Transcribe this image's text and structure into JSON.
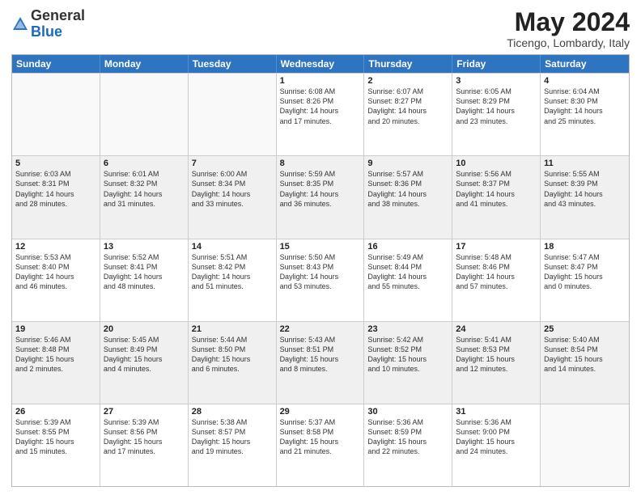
{
  "header": {
    "logo_general": "General",
    "logo_blue": "Blue",
    "month_title": "May 2024",
    "location": "Ticengo, Lombardy, Italy"
  },
  "calendar": {
    "days": [
      "Sunday",
      "Monday",
      "Tuesday",
      "Wednesday",
      "Thursday",
      "Friday",
      "Saturday"
    ],
    "rows": [
      [
        {
          "num": "",
          "info": "",
          "empty": true
        },
        {
          "num": "",
          "info": "",
          "empty": true
        },
        {
          "num": "",
          "info": "",
          "empty": true
        },
        {
          "num": "1",
          "info": "Sunrise: 6:08 AM\nSunset: 8:26 PM\nDaylight: 14 hours\nand 17 minutes.",
          "empty": false
        },
        {
          "num": "2",
          "info": "Sunrise: 6:07 AM\nSunset: 8:27 PM\nDaylight: 14 hours\nand 20 minutes.",
          "empty": false
        },
        {
          "num": "3",
          "info": "Sunrise: 6:05 AM\nSunset: 8:29 PM\nDaylight: 14 hours\nand 23 minutes.",
          "empty": false
        },
        {
          "num": "4",
          "info": "Sunrise: 6:04 AM\nSunset: 8:30 PM\nDaylight: 14 hours\nand 25 minutes.",
          "empty": false
        }
      ],
      [
        {
          "num": "5",
          "info": "Sunrise: 6:03 AM\nSunset: 8:31 PM\nDaylight: 14 hours\nand 28 minutes.",
          "empty": false
        },
        {
          "num": "6",
          "info": "Sunrise: 6:01 AM\nSunset: 8:32 PM\nDaylight: 14 hours\nand 31 minutes.",
          "empty": false
        },
        {
          "num": "7",
          "info": "Sunrise: 6:00 AM\nSunset: 8:34 PM\nDaylight: 14 hours\nand 33 minutes.",
          "empty": false
        },
        {
          "num": "8",
          "info": "Sunrise: 5:59 AM\nSunset: 8:35 PM\nDaylight: 14 hours\nand 36 minutes.",
          "empty": false
        },
        {
          "num": "9",
          "info": "Sunrise: 5:57 AM\nSunset: 8:36 PM\nDaylight: 14 hours\nand 38 minutes.",
          "empty": false
        },
        {
          "num": "10",
          "info": "Sunrise: 5:56 AM\nSunset: 8:37 PM\nDaylight: 14 hours\nand 41 minutes.",
          "empty": false
        },
        {
          "num": "11",
          "info": "Sunrise: 5:55 AM\nSunset: 8:39 PM\nDaylight: 14 hours\nand 43 minutes.",
          "empty": false
        }
      ],
      [
        {
          "num": "12",
          "info": "Sunrise: 5:53 AM\nSunset: 8:40 PM\nDaylight: 14 hours\nand 46 minutes.",
          "empty": false
        },
        {
          "num": "13",
          "info": "Sunrise: 5:52 AM\nSunset: 8:41 PM\nDaylight: 14 hours\nand 48 minutes.",
          "empty": false
        },
        {
          "num": "14",
          "info": "Sunrise: 5:51 AM\nSunset: 8:42 PM\nDaylight: 14 hours\nand 51 minutes.",
          "empty": false
        },
        {
          "num": "15",
          "info": "Sunrise: 5:50 AM\nSunset: 8:43 PM\nDaylight: 14 hours\nand 53 minutes.",
          "empty": false
        },
        {
          "num": "16",
          "info": "Sunrise: 5:49 AM\nSunset: 8:44 PM\nDaylight: 14 hours\nand 55 minutes.",
          "empty": false
        },
        {
          "num": "17",
          "info": "Sunrise: 5:48 AM\nSunset: 8:46 PM\nDaylight: 14 hours\nand 57 minutes.",
          "empty": false
        },
        {
          "num": "18",
          "info": "Sunrise: 5:47 AM\nSunset: 8:47 PM\nDaylight: 15 hours\nand 0 minutes.",
          "empty": false
        }
      ],
      [
        {
          "num": "19",
          "info": "Sunrise: 5:46 AM\nSunset: 8:48 PM\nDaylight: 15 hours\nand 2 minutes.",
          "empty": false
        },
        {
          "num": "20",
          "info": "Sunrise: 5:45 AM\nSunset: 8:49 PM\nDaylight: 15 hours\nand 4 minutes.",
          "empty": false
        },
        {
          "num": "21",
          "info": "Sunrise: 5:44 AM\nSunset: 8:50 PM\nDaylight: 15 hours\nand 6 minutes.",
          "empty": false
        },
        {
          "num": "22",
          "info": "Sunrise: 5:43 AM\nSunset: 8:51 PM\nDaylight: 15 hours\nand 8 minutes.",
          "empty": false
        },
        {
          "num": "23",
          "info": "Sunrise: 5:42 AM\nSunset: 8:52 PM\nDaylight: 15 hours\nand 10 minutes.",
          "empty": false
        },
        {
          "num": "24",
          "info": "Sunrise: 5:41 AM\nSunset: 8:53 PM\nDaylight: 15 hours\nand 12 minutes.",
          "empty": false
        },
        {
          "num": "25",
          "info": "Sunrise: 5:40 AM\nSunset: 8:54 PM\nDaylight: 15 hours\nand 14 minutes.",
          "empty": false
        }
      ],
      [
        {
          "num": "26",
          "info": "Sunrise: 5:39 AM\nSunset: 8:55 PM\nDaylight: 15 hours\nand 15 minutes.",
          "empty": false
        },
        {
          "num": "27",
          "info": "Sunrise: 5:39 AM\nSunset: 8:56 PM\nDaylight: 15 hours\nand 17 minutes.",
          "empty": false
        },
        {
          "num": "28",
          "info": "Sunrise: 5:38 AM\nSunset: 8:57 PM\nDaylight: 15 hours\nand 19 minutes.",
          "empty": false
        },
        {
          "num": "29",
          "info": "Sunrise: 5:37 AM\nSunset: 8:58 PM\nDaylight: 15 hours\nand 21 minutes.",
          "empty": false
        },
        {
          "num": "30",
          "info": "Sunrise: 5:36 AM\nSunset: 8:59 PM\nDaylight: 15 hours\nand 22 minutes.",
          "empty": false
        },
        {
          "num": "31",
          "info": "Sunrise: 5:36 AM\nSunset: 9:00 PM\nDaylight: 15 hours\nand 24 minutes.",
          "empty": false
        },
        {
          "num": "",
          "info": "",
          "empty": true
        }
      ]
    ]
  }
}
